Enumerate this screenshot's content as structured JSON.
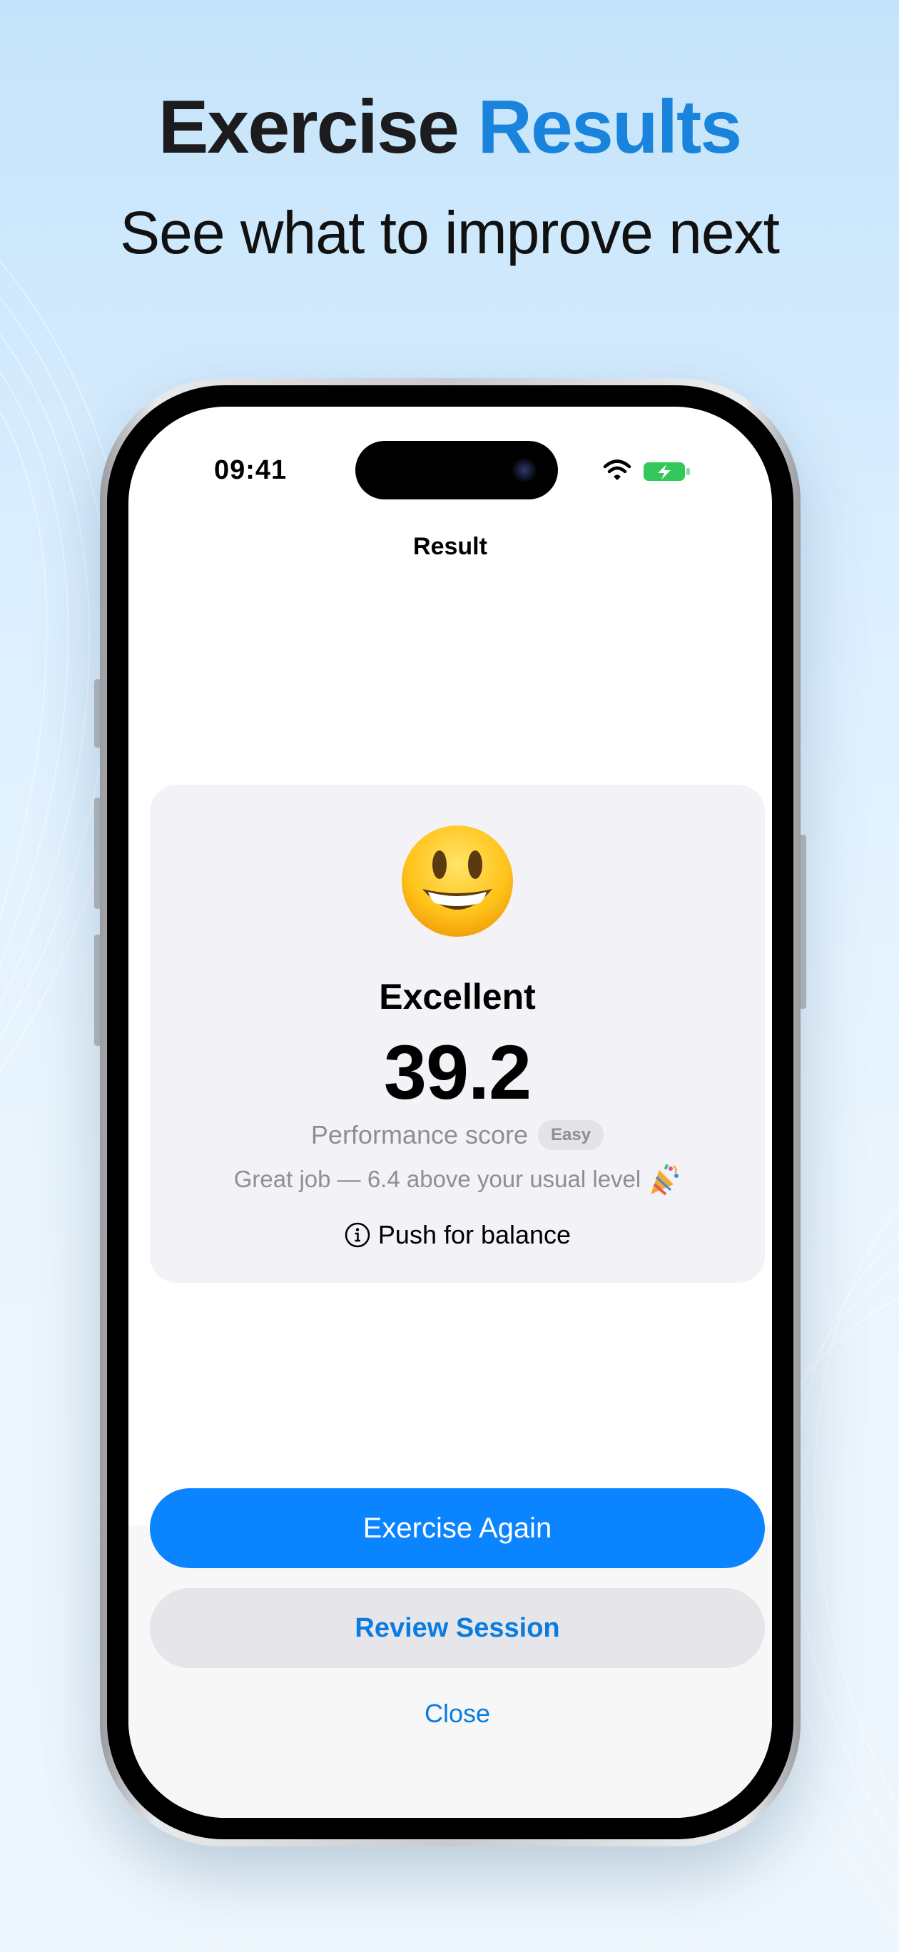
{
  "header": {
    "title_main": "Exercise",
    "title_accent": "Results",
    "subtitle": "See what to improve next"
  },
  "status_bar": {
    "time": "09:41",
    "icons": [
      "wifi-icon",
      "battery-charging-icon"
    ]
  },
  "nav": {
    "title": "Result"
  },
  "result": {
    "emoji": "grinning-face-icon",
    "rating": "Excellent",
    "score": "39.2",
    "score_label": "Performance score",
    "difficulty_badge": "Easy",
    "comparison": "Great job — 6.4 above your usual level",
    "comparison_icon": "party-popper-icon",
    "tip": "Push for balance",
    "tip_icon": "info-icon"
  },
  "actions": {
    "primary_label": "Exercise Again",
    "secondary_label": "Review Session",
    "close_label": "Close"
  },
  "colors": {
    "accent": "#1a84dc",
    "button_primary": "#0a84ff",
    "link": "#0a7ce0",
    "card_background": "#f2f2f7"
  }
}
